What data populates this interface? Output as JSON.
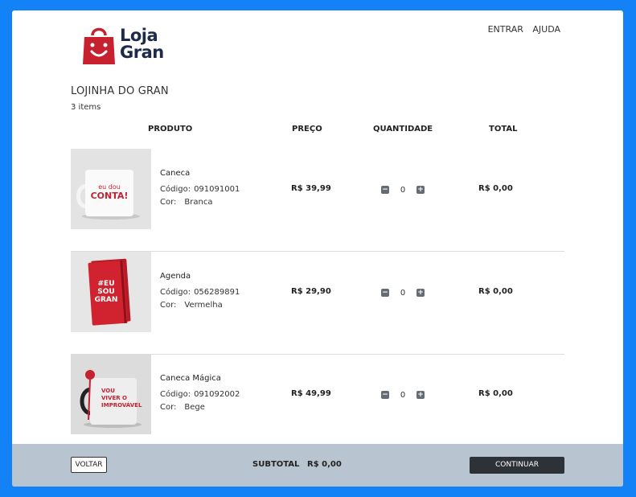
{
  "brand": {
    "line1": "Loja",
    "line2": "Gran"
  },
  "nav": {
    "entrar": "ENTRAR",
    "ajuda": "AJUDA"
  },
  "store": {
    "title": "LOJINHA DO GRAN",
    "items_count": "3 items"
  },
  "columns": {
    "produto": "PRODUTO",
    "preco": "PREÇO",
    "quantidade": "QUANTIDADE",
    "total": "TOTAL"
  },
  "labels": {
    "codigo": "Código:",
    "cor": "Cor:"
  },
  "products": [
    {
      "name": "Caneca",
      "code": "091091001",
      "color": "Branca",
      "price": "R$ 39,99",
      "qty": "0",
      "total": "R$ 0,00",
      "print": [
        "eu dou",
        "CONTA!"
      ]
    },
    {
      "name": "Agenda",
      "code": "056289891",
      "color": "Vermelha",
      "price": "R$ 29,90",
      "qty": "0",
      "total": "R$ 0,00",
      "print": [
        "#EU",
        "SOU",
        "GRAN"
      ]
    },
    {
      "name": "Caneca Mágica",
      "code": "091092002",
      "color": "Bege",
      "price": "R$ 49,99",
      "qty": "0",
      "total": "R$ 0,00",
      "print": [
        "VOU",
        "VIVER O",
        "IMPROVÁVEL"
      ]
    }
  ],
  "footer": {
    "voltar": "VOLTAR",
    "subtotal_label": "SUBTOTAL",
    "subtotal_value": "R$ 0,00",
    "continuar": "CONTINUAR"
  },
  "colors": {
    "background": "#1282f6",
    "brand_red": "#c7202f",
    "brand_navy": "#1d2a4a",
    "footer": "#b8c4cf",
    "button_dark": "#2d3238"
  }
}
